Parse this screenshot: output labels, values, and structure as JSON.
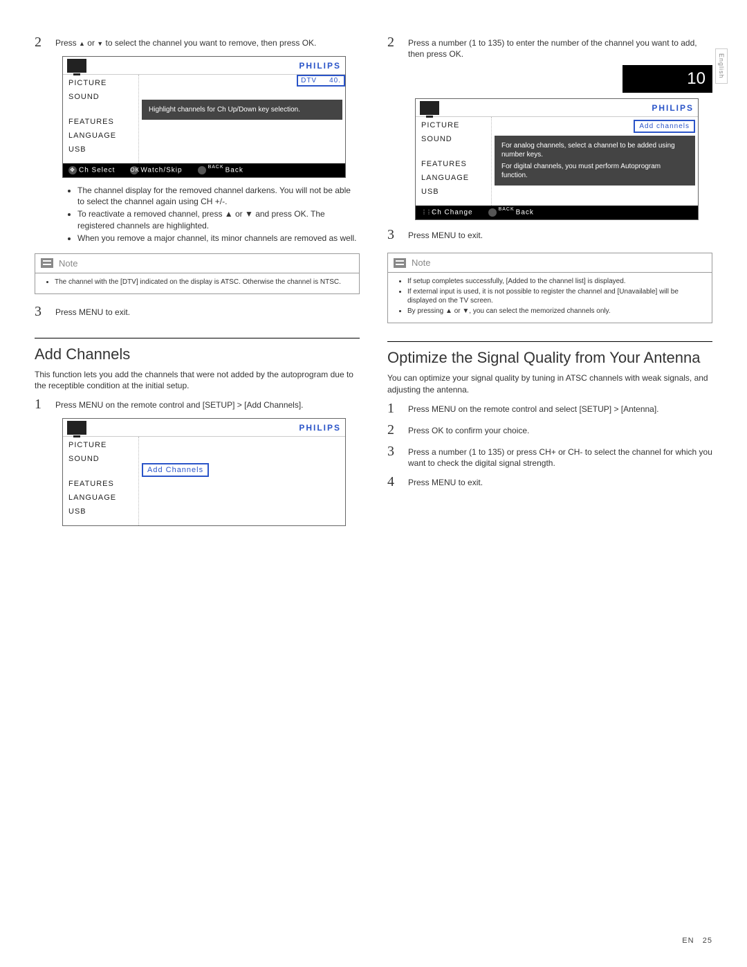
{
  "lang_tab": "English",
  "footer": {
    "lang": "EN",
    "page": "25"
  },
  "left": {
    "step2_prefix": "Press ",
    "step2_mid": " or ",
    "step2_suffix": " to select the channel you want to remove, then press OK.",
    "menu1": {
      "brand": "PHILIPS",
      "items": [
        "PICTURE",
        "SOUND",
        "FEATURES",
        "LANGUAGE",
        "USB"
      ],
      "dtv_label": "DTV",
      "dtv_value": "40.",
      "hint": "Highlight channels for Ch Up/Down key selection.",
      "footer_a": "Ch Select",
      "footer_b": "Watch/Skip",
      "footer_c": "Back",
      "footer_c_sup": "BACK"
    },
    "bullets": [
      "The channel display for the removed channel darkens. You will not be able to select the channel again using CH +/-.",
      "To reactivate a removed channel, press ▲ or ▼ and press OK. The registered channels are highlighted.",
      "When you remove a major channel, its minor channels are removed as well."
    ],
    "note_label": "Note",
    "note_items": [
      "The channel with the [DTV] indicated on the display is ATSC. Otherwise the channel is NTSC."
    ],
    "step3": "Press MENU to exit.",
    "section_title": "Add Channels",
    "section_body": "This function lets you add the channels that were not added by the autoprogram due to the receptible condition at the initial setup.",
    "add_step1": "Press MENU on the remote control and [SETUP] > [Add Channels].",
    "menu2": {
      "brand": "PHILIPS",
      "items": [
        "PICTURE",
        "SOUND",
        "FEATURES",
        "LANGUAGE",
        "USB"
      ],
      "badge": "Add Channels"
    }
  },
  "right": {
    "step2": "Press a number (1 to 135) to enter the number of the channel you want to add, then press OK.",
    "chnum": "10",
    "menu3": {
      "brand": "PHILIPS",
      "items": [
        "PICTURE",
        "SOUND",
        "FEATURES",
        "LANGUAGE",
        "USB"
      ],
      "badge": "Add channels",
      "hint1": "For analog channels, select a channel to be added using number keys.",
      "hint2": "For digital channels, you must perform Autoprogram function.",
      "footer_a": "Ch Change",
      "footer_b": "Back",
      "footer_b_sup": "BACK"
    },
    "step3": "Press MENU to exit.",
    "note_label": "Note",
    "note_items": [
      "If setup completes successfully, [Added to the channel list] is displayed.",
      "If external input is used, it is not possible to register the channel and [Unavailable] will be displayed on the TV screen.",
      "By pressing ▲ or ▼, you can select the memorized channels only."
    ],
    "section_title": "Optimize the Signal Quality from Your Antenna",
    "section_body": "You can optimize your signal quality by tuning in ATSC channels with weak signals, and adjusting the antenna.",
    "opt_step1": "Press MENU on the remote control and select [SETUP] > [Antenna].",
    "opt_step2": "Press OK to conﬁrm your choice.",
    "opt_step3": "Press a number (1 to 135) or press CH+ or CH- to select the channel for which you want to check the digital signal strength.",
    "opt_step4": "Press MENU to exit."
  }
}
